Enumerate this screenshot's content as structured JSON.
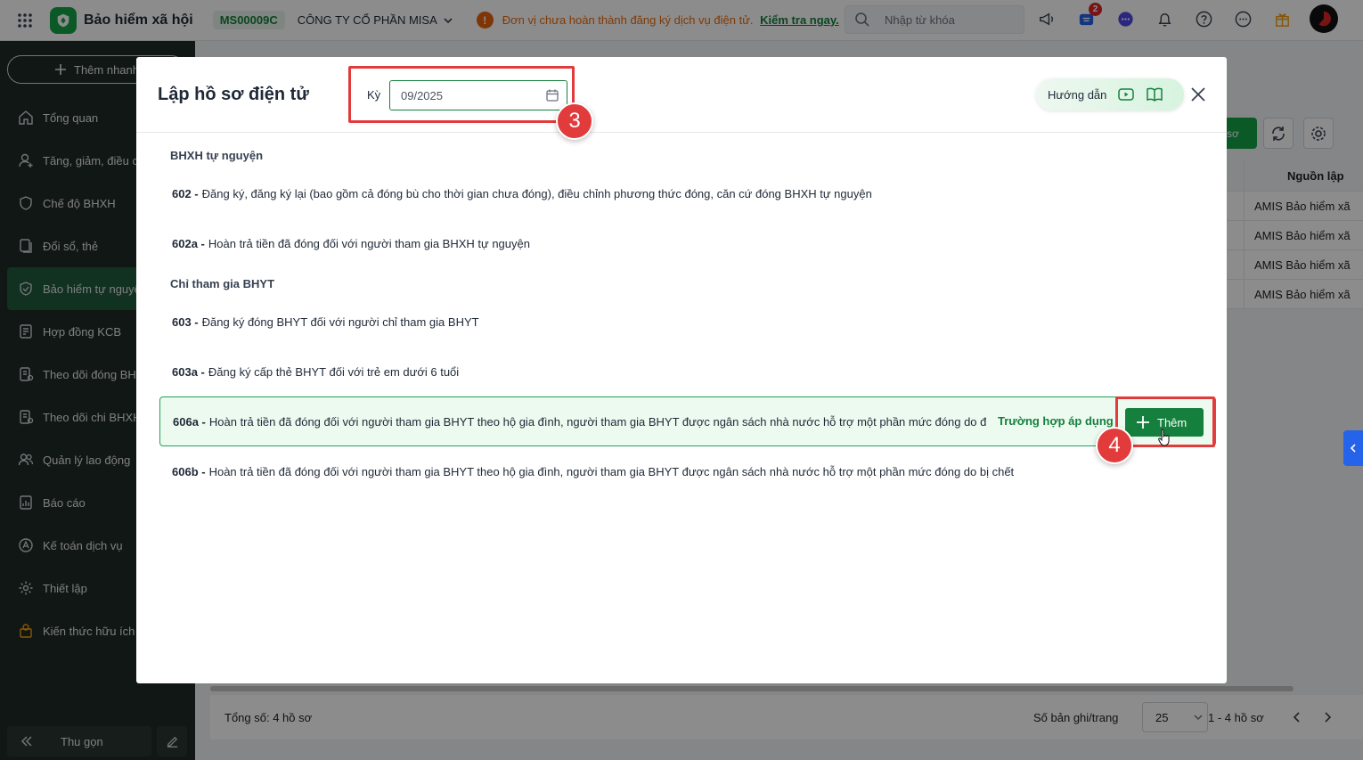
{
  "topbar": {
    "app_title": "Bảo hiểm xã hội",
    "tax_code": "MS00009C",
    "company_name": "CÔNG TY CỔ PHẦN MISA",
    "warning_icon_text": "!",
    "warning_text": "Đơn vị chưa hoàn thành đăng ký dịch vụ điện tử.",
    "warning_link": "Kiểm tra ngay.",
    "search_placeholder": "Nhập từ khóa",
    "cart_badge": "2",
    "icons": [
      "megaphone-icon",
      "cart-icon",
      "chat-icon",
      "bell-icon",
      "help-icon",
      "more-icon",
      "gift-icon"
    ]
  },
  "sidebar": {
    "quick_add": "Thêm nhanh",
    "items": [
      {
        "label": "Tổng quan",
        "icon": "home-icon"
      },
      {
        "label": "Tăng, giảm, điều c",
        "icon": "user-icon"
      },
      {
        "label": "Chế độ BHXH",
        "icon": "shield-icon"
      },
      {
        "label": "Đổi sổ, thẻ",
        "icon": "card-icon"
      },
      {
        "label": "Bảo hiểm tự nguyệ",
        "icon": "shield-check-icon",
        "active": true
      },
      {
        "label": "Hợp đồng KCB",
        "icon": "contract-icon"
      },
      {
        "label": "Theo dõi đóng BH",
        "icon": "tracking-icon"
      },
      {
        "label": "Theo dõi chi BHXH",
        "icon": "tracking-icon"
      },
      {
        "label": "Quản lý lao động",
        "icon": "users-icon"
      },
      {
        "label": "Báo cáo",
        "icon": "report-icon"
      },
      {
        "label": "Kế toán dịch vụ",
        "icon": "accounting-icon"
      },
      {
        "label": "Thiết lập",
        "icon": "gear-icon"
      },
      {
        "label": "Kiến thức hữu ích",
        "icon": "knowledge-icon"
      }
    ],
    "collapse_label": "Thu gọn"
  },
  "background": {
    "partial_button_label": "sơ",
    "table_header_source": "Nguồn lập",
    "rows": [
      "AMIS Bảo hiểm xã",
      "AMIS Bảo hiểm xã",
      "AMIS Bảo hiểm xã",
      "AMIS Bảo hiểm xã"
    ],
    "total_label": "Tổng số: 4 hồ sơ",
    "per_page_label": "Số bản ghi/trang",
    "per_page_value": "25",
    "range_label": "1 - 4 hồ sơ"
  },
  "modal": {
    "title": "Lập hồ sơ điện tử",
    "period_label": "Kỳ",
    "period_value": "09/2025",
    "guide_label": "Hướng dẫn",
    "step_3": "3",
    "step_4": "4",
    "groups": [
      {
        "title": "BHXH tự nguyện",
        "forms": [
          {
            "code": "602 -",
            "desc": "Đăng ký, đăng ký lại (bao gồm cả đóng bù cho thời gian chưa đóng), điều chỉnh phương thức đóng, căn cứ đóng BHXH tự nguyện"
          },
          {
            "code": "602a -",
            "desc": "Hoàn trả tiền đã đóng đối với người tham gia BHXH tự nguyện"
          }
        ]
      },
      {
        "title": "Chỉ tham gia BHYT",
        "forms": [
          {
            "code": "603 -",
            "desc": "Đăng ký đóng BHYT đối với người chỉ tham gia BHYT"
          },
          {
            "code": "603a -",
            "desc": "Đăng ký cấp thẻ BHYT đối với trẻ em dưới 6 tuổi"
          },
          {
            "code": "606a -",
            "desc": "Hoàn trả tiền đã đóng đối với người tham gia BHYT theo hộ gia đình, người tham gia BHYT được ngân sách nhà nước hỗ trợ một phần mức đóng do đón",
            "highlighted": true
          },
          {
            "code": "606b -",
            "desc": "Hoàn trả tiền đã đóng đối với người tham gia BHYT theo hộ gia đình, người tham gia BHYT được ngân sách nhà nước hỗ trợ một phần mức đóng do bị chết"
          }
        ]
      }
    ],
    "cases_link": "Trường hợp áp dụng",
    "add_label": "Thêm"
  },
  "colors": {
    "primary_green": "#15803d",
    "sidebar_bg": "#1f2a27",
    "annotation_red": "#e23b3b",
    "warning_orange": "#ea6a0a"
  }
}
